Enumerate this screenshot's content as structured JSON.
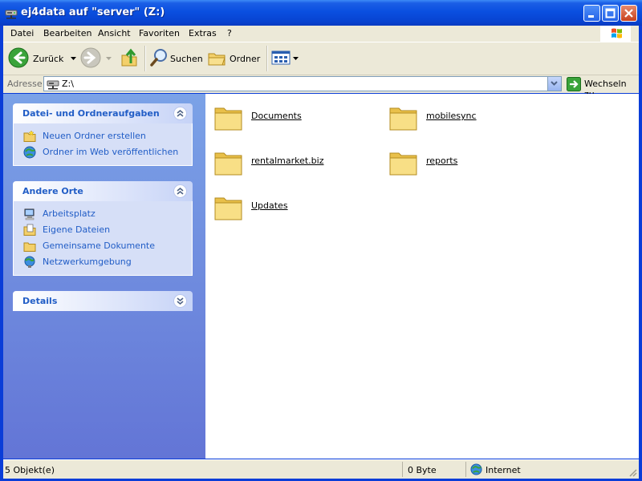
{
  "window": {
    "title": "ej4data auf \"server\" (Z:)"
  },
  "menu": [
    "Datei",
    "Bearbeiten",
    "Ansicht",
    "Favoriten",
    "Extras",
    "?"
  ],
  "toolbar": {
    "back": "Zurück",
    "search": "Suchen",
    "folders": "Ordner"
  },
  "address": {
    "label": "Adresse",
    "value": "Z:\\",
    "go": "Wechseln zu"
  },
  "tasks_file": {
    "title": "Datei- und Ordneraufgaben",
    "items": [
      "Neuen Ordner erstellen",
      "Ordner im Web veröffentlichen"
    ]
  },
  "other_places": {
    "title": "Andere Orte",
    "items": [
      "Arbeitsplatz",
      "Eigene Dateien",
      "Gemeinsame Dokumente",
      "Netzwerkumgebung"
    ]
  },
  "details": {
    "title": "Details"
  },
  "folders": [
    "Documents",
    "mobilesync",
    "rentalmarket.biz",
    "reports",
    "Updates"
  ],
  "status": {
    "objects": "5 Objekt(e)",
    "size": "0 Byte",
    "zone": "Internet"
  },
  "colors": {
    "titlebar": "#0a4fe0",
    "pane": "#6375d6",
    "link": "#215dc6",
    "chrome": "#ece9d8"
  }
}
